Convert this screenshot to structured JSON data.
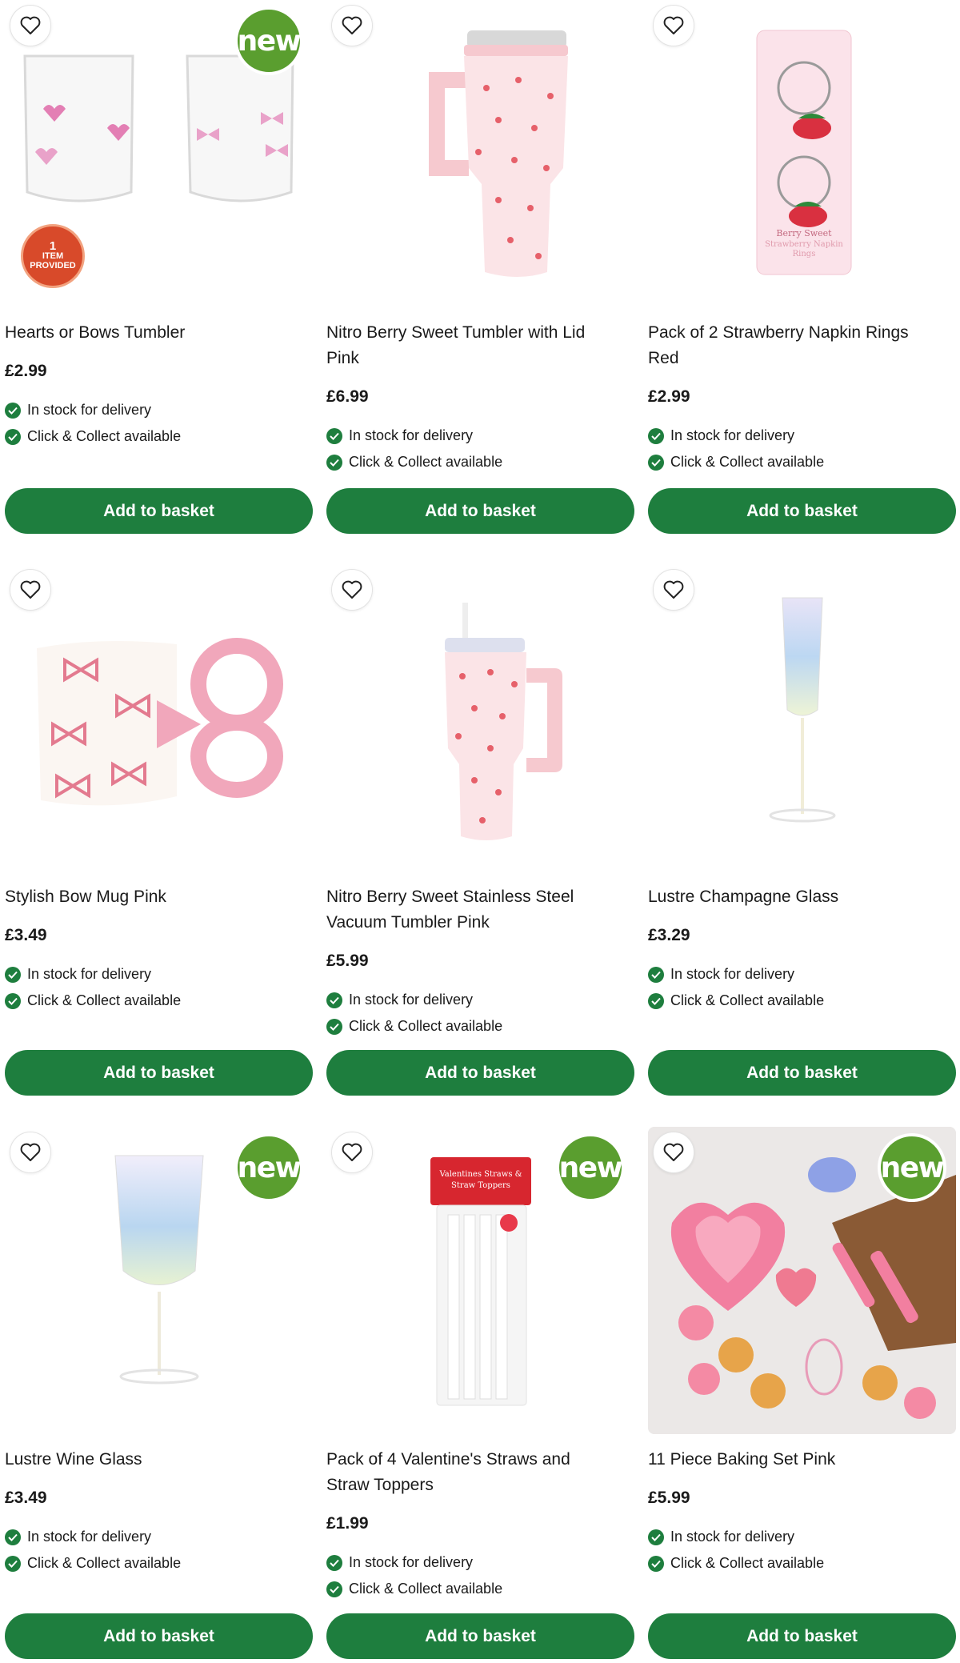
{
  "colors": {
    "brand_green": "#1e7e3e",
    "new_badge": "#5a9e2f",
    "item_badge": "#d84a2a"
  },
  "products": [
    {
      "title": "Hearts or Bows Tumbler",
      "price": "£2.99",
      "delivery": "In stock for delivery",
      "collect": "Click & Collect available",
      "button": "Add to basket",
      "badge_new": "new",
      "item_badge_count": "1",
      "item_badge_text1": "ITEM",
      "item_badge_text2": "PROVIDED"
    },
    {
      "title": "Nitro Berry Sweet Tumbler with Lid Pink",
      "price": "£6.99",
      "delivery": "In stock for delivery",
      "collect": "Click & Collect available",
      "button": "Add to basket"
    },
    {
      "title": "Pack of 2 Strawberry Napkin Rings Red",
      "price": "£2.99",
      "delivery": "In stock for delivery",
      "collect": "Click & Collect available",
      "button": "Add to basket",
      "pack_text": "Berry Sweet Strawberry Napkin Rings"
    },
    {
      "title": "Stylish Bow Mug Pink",
      "price": "£3.49",
      "delivery": "In stock for delivery",
      "collect": "Click & Collect available",
      "button": "Add to basket"
    },
    {
      "title": "Nitro Berry Sweet Stainless Steel Vacuum Tumbler Pink",
      "price": "£5.99",
      "delivery": "In stock for delivery",
      "collect": "Click & Collect available",
      "button": "Add to basket"
    },
    {
      "title": "Lustre Champagne Glass",
      "price": "£3.29",
      "delivery": "In stock for delivery",
      "collect": "Click & Collect available",
      "button": "Add to basket"
    },
    {
      "title": "Lustre Wine Glass",
      "price": "£3.49",
      "delivery": "In stock for delivery",
      "collect": "Click & Collect available",
      "button": "Add to basket",
      "badge_new": "new"
    },
    {
      "title": "Pack of 4 Valentine's Straws and Straw Toppers",
      "price": "£1.99",
      "delivery": "In stock for delivery",
      "collect": "Click & Collect available",
      "button": "Add to basket",
      "badge_new": "new",
      "pack_text": "Valentines Straws & Straw Toppers"
    },
    {
      "title": "11 Piece Baking Set Pink",
      "price": "£5.99",
      "delivery": "In stock for delivery",
      "collect": "Click & Collect available",
      "button": "Add to basket",
      "badge_new": "new"
    }
  ]
}
